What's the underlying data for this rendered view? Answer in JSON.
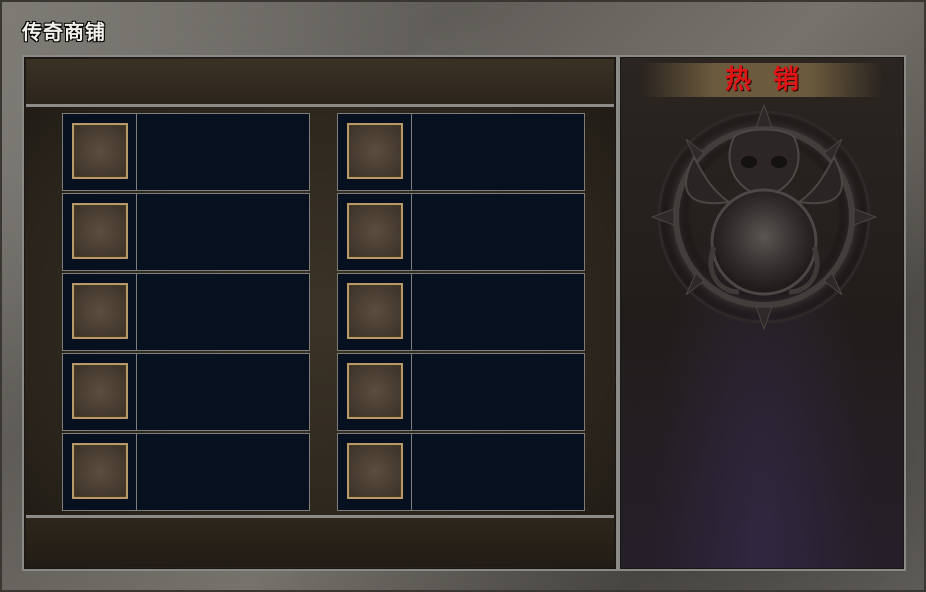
{
  "window": {
    "title": "传奇商铺"
  },
  "shop": {
    "left_column": [
      {
        "name": "",
        "price": ""
      },
      {
        "name": "",
        "price": ""
      },
      {
        "name": "",
        "price": ""
      },
      {
        "name": "",
        "price": ""
      },
      {
        "name": "",
        "price": ""
      }
    ],
    "right_column": [
      {
        "name": "",
        "price": ""
      },
      {
        "name": "",
        "price": ""
      },
      {
        "name": "",
        "price": ""
      },
      {
        "name": "",
        "price": ""
      },
      {
        "name": "",
        "price": ""
      }
    ]
  },
  "hot_panel": {
    "title": "热销"
  },
  "colors": {
    "hot_title": "#e01414",
    "slot_border": "#b79a6a",
    "item_background": "#07101f"
  },
  "icons": {
    "emblem": "demon-skull-emblem-icon"
  }
}
